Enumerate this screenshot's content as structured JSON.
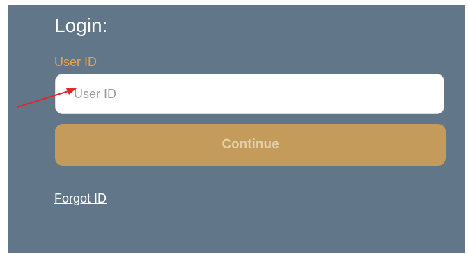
{
  "login": {
    "title": "Login:",
    "user_id_label": "User ID",
    "user_id_placeholder": "User ID",
    "user_id_value": "",
    "continue_label": "Continue",
    "forgot_label": "Forgot ID"
  },
  "colors": {
    "panel_bg": "#617688",
    "label_accent": "#f0a24a",
    "button_bg": "#c49b5a",
    "button_text": "#e3cfa6",
    "annotation_arrow": "#e3262a"
  },
  "annotation": {
    "icon": "red-arrow-icon"
  }
}
